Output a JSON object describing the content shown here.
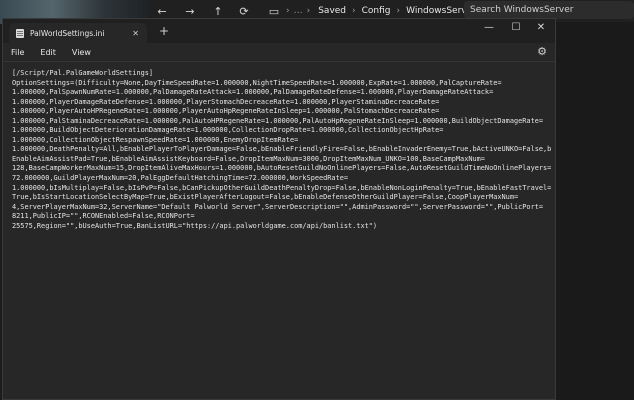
{
  "explorer": {
    "nav": {
      "back": "←",
      "forward": "→",
      "up": "↑",
      "refresh": "⟳",
      "view": "▭"
    },
    "breadcrumbs": [
      "Saved",
      "Config",
      "WindowsServer"
    ],
    "search_placeholder": "Search WindowsServer"
  },
  "notepad": {
    "tab_title": "PalWorldSettings.ini",
    "tab_close": "✕",
    "new_tab": "+",
    "controls": {
      "minimize": "—",
      "maximize": "☐",
      "close": "✕"
    },
    "menu": [
      "File",
      "Edit",
      "View"
    ],
    "settings_icon": "⚙",
    "lines": [
      "[/Script/Pal.PalGameWorldSettings]",
      "OptionSettings=(Difficulty=None,DayTimeSpeedRate=1.000000,NightTimeSpeedRate=1.000000,ExpRate=1.000000,PalCaptureRate=",
      "1.000000,PalSpawnNumRate=1.000000,PalDamageRateAttack=1.000000,PalDamageRateDefense=1.000000,PlayerDamageRateAttack=",
      "1.000000,PlayerDamageRateDefense=1.000000,PlayerStomachDecreaceRate=1.000000,PlayerStaminaDecreaceRate=",
      "1.000000,PlayerAutoHPRegeneRate=1.000000,PlayerAutoHpRegeneRateInSleep=1.000000,PalStomachDecreaceRate=",
      "1.000000,PalStaminaDecreaceRate=1.000000,PalAutoHPRegeneRate=1.000000,PalAutoHpRegeneRateInSleep=1.000000,BuildObjectDamageRate=",
      "1.000000,BuildObjectDeteriorationDamageRate=1.000000,CollectionDropRate=1.000000,CollectionObjectHpRate=",
      "1.000000,CollectionObjectRespawnSpeedRate=1.000000,EnemyDropItemRate=",
      "1.000000,DeathPenalty=All,bEnablePlayerToPlayerDamage=False,bEnableFriendlyFire=False,bEnableInvaderEnemy=True,bActiveUNKO=False,b",
      "EnableAimAssistPad=True,bEnableAimAssistKeyboard=False,DropItemMaxNum=3000,DropItemMaxNum_UNKO=100,BaseCampMaxNum=",
      "128,BaseCampWorkerMaxNum=15,DropItemAliveMaxHours=1.000000,bAutoResetGuildNoOnlinePlayers=False,AutoResetGuildTimeNoOnlinePlayers=",
      "72.000000,GuildPlayerMaxNum=20,PalEggDefaultHatchingTime=72.000000,WorkSpeedRate=",
      "1.000000,bIsMultiplay=False,bIsPvP=False,bCanPickupOtherGuildDeathPenaltyDrop=False,bEnableNonLoginPenalty=True,bEnableFastTravel=",
      "True,bIsStartLocationSelectByMap=True,bExistPlayerAfterLogout=False,bEnableDefenseOtherGuildPlayer=False,CoopPlayerMaxNum=",
      "4,ServerPlayerMaxNum=32,ServerName=\"Default Palworld Server\",ServerDescription=\"\",AdminPassword=\"\",ServerPassword=\"\",PublicPort=",
      "8211,PublicIP=\"\",RCONEnabled=False,RCONPort=",
      "25575,Region=\"\",bUseAuth=True,BanListURL=\"https://api.palworldgame.com/api/banlist.txt\")"
    ]
  }
}
